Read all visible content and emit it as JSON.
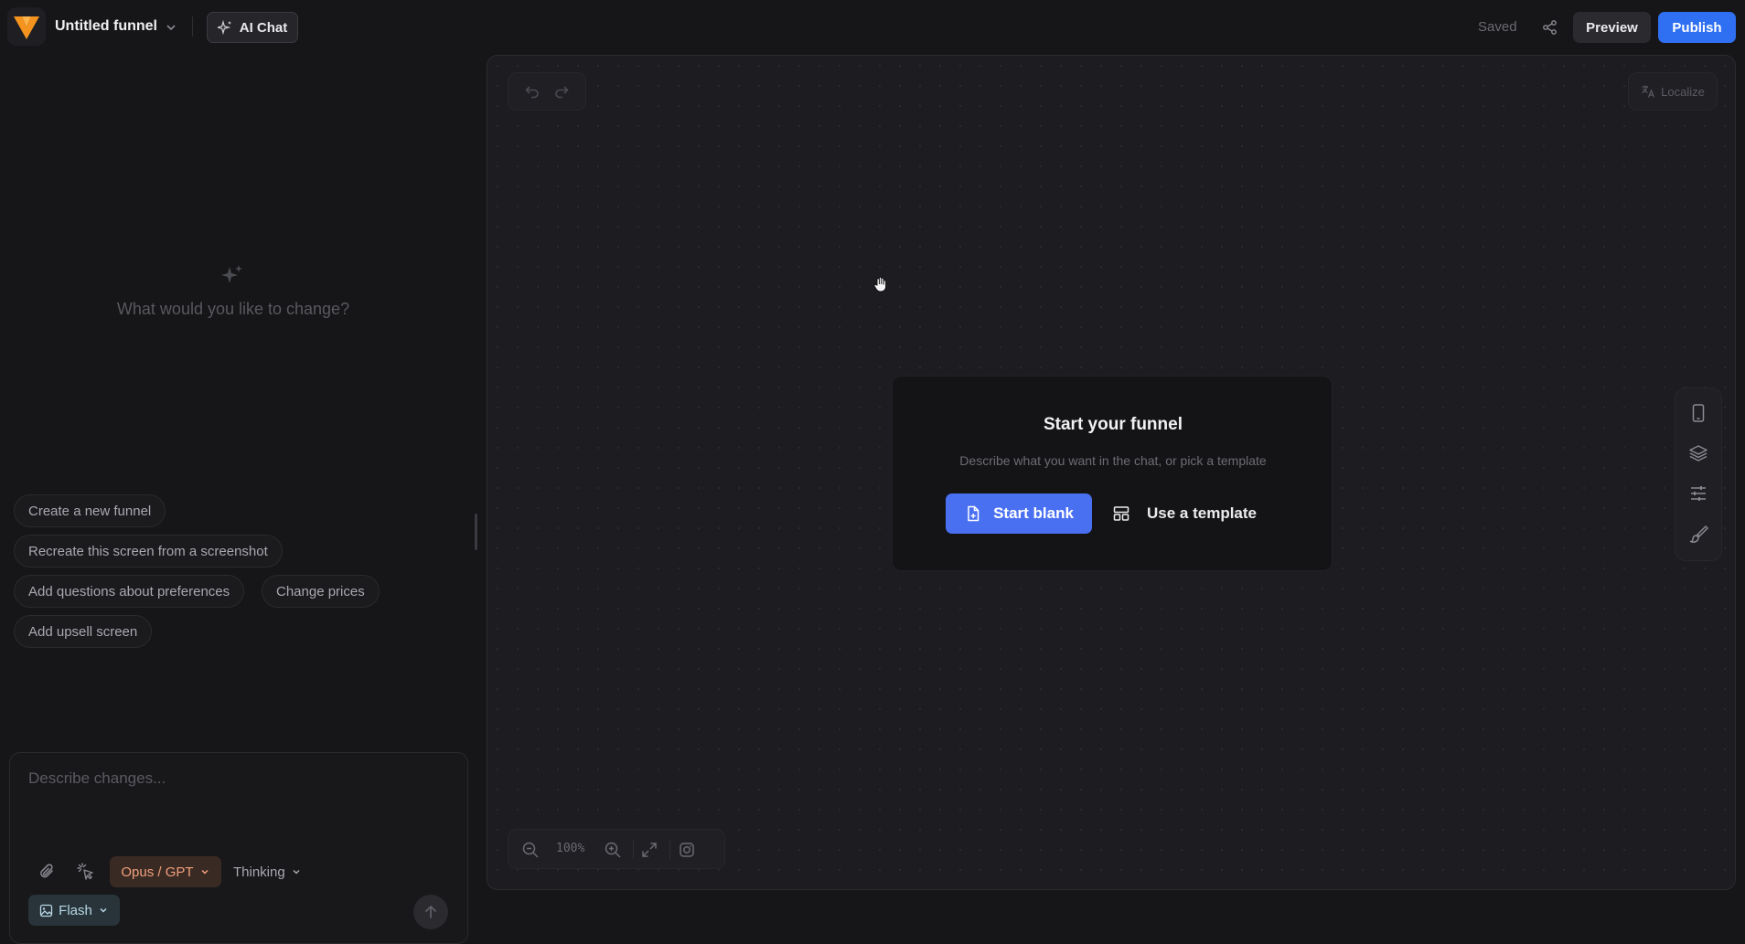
{
  "topbar": {
    "funnel_name": "Untitled funnel",
    "ai_chat_label": "AI Chat",
    "status": "Saved",
    "preview_label": "Preview",
    "publish_label": "Publish"
  },
  "chat": {
    "empty_prompt": "What would you like to change?",
    "suggestions": [
      "Create a new funnel",
      "Recreate this screen from a screenshot",
      "Add questions about preferences",
      "Change prices",
      "Add upsell screen"
    ],
    "composer": {
      "placeholder": "Describe changes...",
      "value": "",
      "model": "Opus / GPT",
      "thinking": "Thinking",
      "image_model": "Flash"
    }
  },
  "canvas": {
    "localize_label": "Localize",
    "zoom_level": "100%",
    "start_card": {
      "title": "Start your funnel",
      "subtitle": "Describe what you want in the chat, or pick a template",
      "start_blank_label": "Start blank",
      "template_label": "Use a template"
    }
  },
  "colors": {
    "background": "#161618",
    "accent_blue": "#2f6ff2",
    "start_blank_blue": "#4a70f2",
    "model_orange": "#f0a07c",
    "logo_orange": "#f5931f"
  },
  "icons": [
    "logo",
    "chevron-down-icon",
    "sparkles-icon",
    "share-icon",
    "undo-icon",
    "redo-icon",
    "translate-icon",
    "hand-cursor-icon",
    "phone-icon",
    "layers-icon",
    "sliders-icon",
    "paintbrush-icon",
    "zoom-out-icon",
    "zoom-in-icon",
    "expand-icon",
    "camera-icon",
    "file-plus-icon",
    "template-icon",
    "paperclip-icon",
    "pointer-click-icon",
    "image-icon",
    "arrow-up-icon"
  ]
}
